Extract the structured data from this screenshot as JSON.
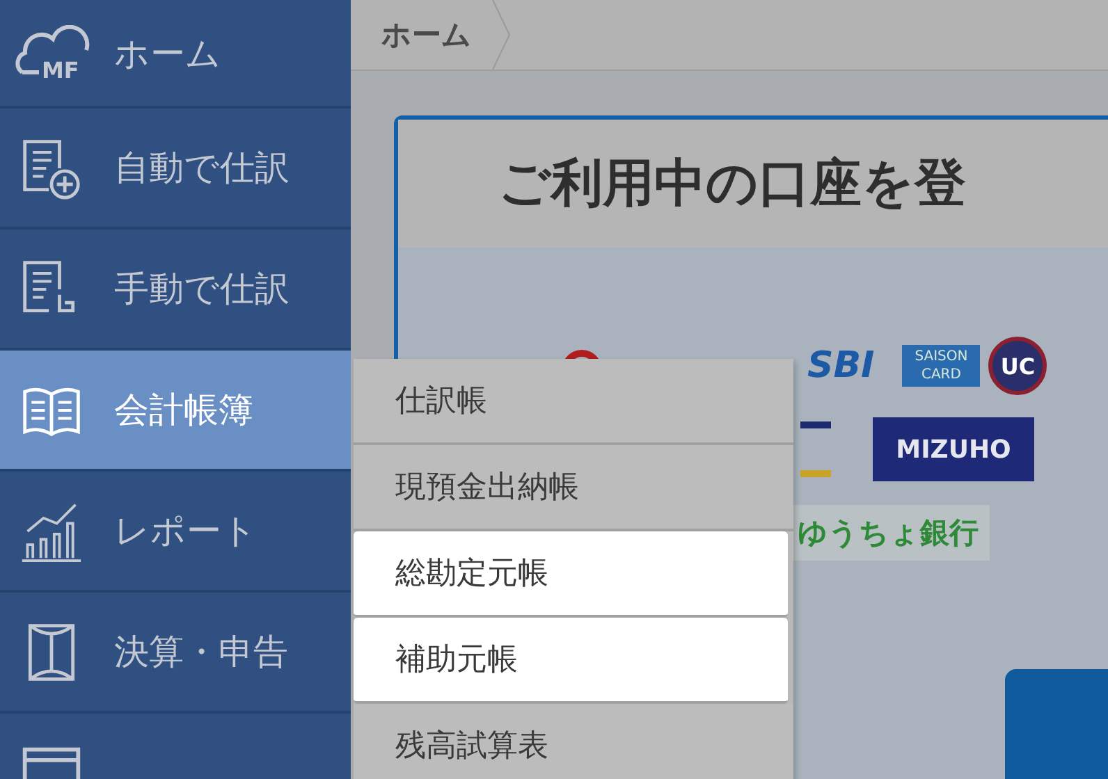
{
  "sidebar": {
    "logo_mark": "MF",
    "items": [
      {
        "label": "ホーム",
        "selected": false
      },
      {
        "label": "自動で仕訳",
        "selected": false
      },
      {
        "label": "手動で仕訳",
        "selected": false
      },
      {
        "label": "会計帳簿",
        "selected": true
      },
      {
        "label": "レポート",
        "selected": false
      },
      {
        "label": "決算・申告",
        "selected": false
      },
      {
        "selected": false
      }
    ]
  },
  "submenu": {
    "items": [
      {
        "label": "仕訳帳",
        "highlighted": false
      },
      {
        "label": "現預金出納帳",
        "highlighted": false
      },
      {
        "label": "総勘定元帳",
        "highlighted": true
      },
      {
        "label": "補助元帳",
        "highlighted": true
      },
      {
        "label": "残高試算表",
        "highlighted": false
      }
    ]
  },
  "breadcrumb": {
    "items": [
      "ホーム"
    ]
  },
  "card": {
    "title": "ご利用中の口座を登",
    "logos": [
      {
        "kind": "sbi",
        "label": "SBI"
      },
      {
        "kind": "saison",
        "label": "SAISON CARD"
      },
      {
        "kind": "uc",
        "label": "UC"
      },
      {
        "kind": "mizuho",
        "label": "MIZUHO"
      },
      {
        "kind": "yucho",
        "label": "ゆうちょ銀行"
      }
    ]
  }
}
